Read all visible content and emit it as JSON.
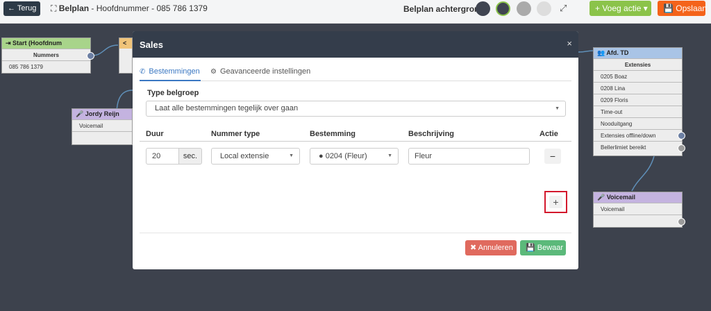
{
  "topbar": {
    "back_label": "← Terug",
    "breadcrumb_title": "Belplan",
    "breadcrumb_sub": " - Hoofdnummer - 085 786 1379",
    "background_label": "Belplan achtergrond",
    "swatches": [
      "#3f4450",
      "#3f4450",
      "#aaaaaa",
      "#dddddd"
    ],
    "add_action_label": "+ Voeg actie ▾",
    "save_label": "💾 Opslaan"
  },
  "canvas": {
    "start_node": {
      "title": "⇥ Start (Hoofdnum",
      "header_row": "Nummers",
      "row": "085 786 1379"
    },
    "jordy_node": {
      "title": "🎤 Jordy Reijn",
      "row": "Voicemail"
    },
    "afd_node": {
      "title": "👥 Afd. TD",
      "header_row": "Extensies",
      "rows": [
        "0205 Boaz",
        "0208 Lina",
        "0209 Floris",
        "Time-out",
        "Nooduitgang",
        "Extensies offline/down",
        "Bellerlimiet bereikt"
      ]
    },
    "voicemail_node": {
      "title": "🎤 Voicemail",
      "row": "Voicemail"
    }
  },
  "modal": {
    "title": "Sales",
    "close": "×",
    "tabs": [
      {
        "label": "Bestemmingen",
        "icon": "phone-icon"
      },
      {
        "label": "Geavanceerde instellingen",
        "icon": "gear-icon"
      }
    ],
    "type_label": "Type belgroep",
    "type_value": "Laat alle bestemmingen tegelijk over gaan",
    "columns": [
      "Duur",
      "Nummer type",
      "Bestemming",
      "Beschrijving",
      "Actie"
    ],
    "row": {
      "duration": "20",
      "duration_unit": "sec.",
      "number_type": "Local extensie",
      "destination": "● 0204 (Fleur)",
      "description": "Fleur"
    },
    "minus": "−",
    "plus": "+",
    "cancel_label": "✖ Annuleren",
    "save_label": "💾 Bewaar"
  },
  "colors": {
    "accent": "#3a77c2",
    "highlight": "#d3182c",
    "cancel": "#e06a5e",
    "save": "#5bb97a"
  }
}
